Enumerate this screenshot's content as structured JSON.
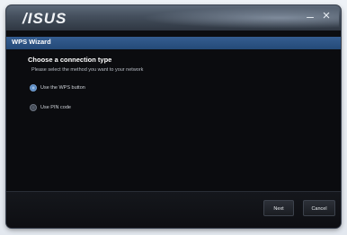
{
  "window": {
    "brand": "/ISUS",
    "minimize_glyph": "–",
    "close_glyph": "×"
  },
  "wizard": {
    "title": "WPS Wizard",
    "heading": "Choose a connection type",
    "description": "Please select the method you want to your network",
    "options": [
      {
        "label": "Use the WPS button",
        "selected": true
      },
      {
        "label": "Use PIN code",
        "selected": false
      }
    ]
  },
  "footer": {
    "next_label": "Next",
    "cancel_label": "Cancel"
  }
}
